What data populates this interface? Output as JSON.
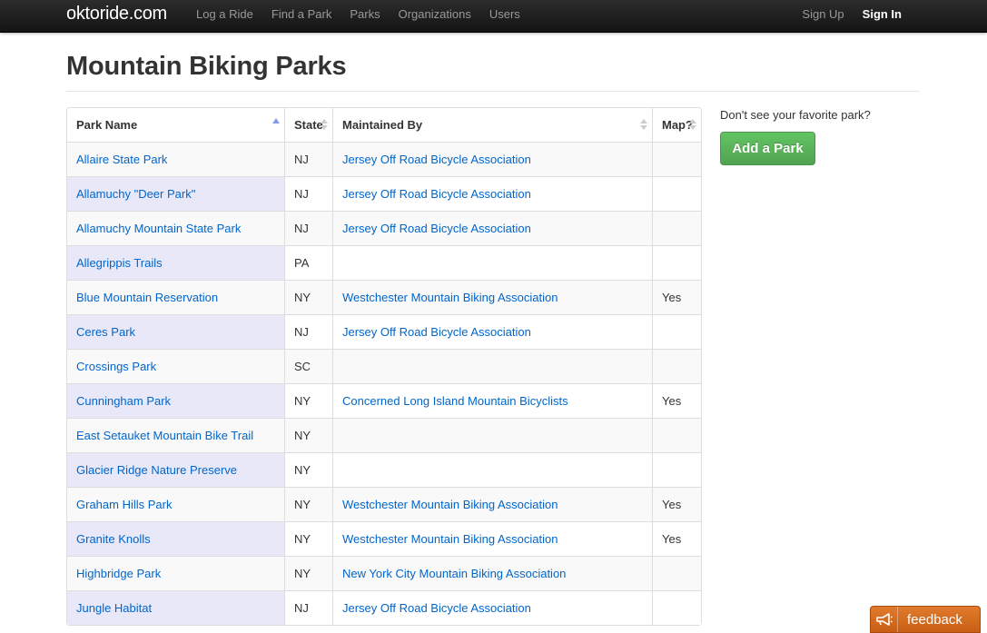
{
  "navbar": {
    "brand": "oktoride.com",
    "links": [
      "Log a Ride",
      "Find a Park",
      "Parks",
      "Organizations",
      "Users"
    ],
    "sign_up": "Sign Up",
    "sign_in": "Sign In"
  },
  "page": {
    "title": "Mountain Biking Parks"
  },
  "table": {
    "headers": {
      "park_name": "Park Name",
      "state": "State",
      "maintained_by": "Maintained By",
      "map": "Map?"
    },
    "rows": [
      {
        "name": "Allaire State Park",
        "state": "NJ",
        "org": "Jersey Off Road Bicycle Association",
        "map": ""
      },
      {
        "name": "Allamuchy \"Deer Park\"",
        "state": "NJ",
        "org": "Jersey Off Road Bicycle Association",
        "map": ""
      },
      {
        "name": "Allamuchy Mountain State Park",
        "state": "NJ",
        "org": "Jersey Off Road Bicycle Association",
        "map": ""
      },
      {
        "name": "Allegrippis Trails",
        "state": "PA",
        "org": "",
        "map": ""
      },
      {
        "name": "Blue Mountain Reservation",
        "state": "NY",
        "org": "Westchester Mountain Biking Association",
        "map": "Yes"
      },
      {
        "name": "Ceres Park",
        "state": "NJ",
        "org": "Jersey Off Road Bicycle Association",
        "map": ""
      },
      {
        "name": "Crossings Park",
        "state": "SC",
        "org": "",
        "map": ""
      },
      {
        "name": "Cunningham Park",
        "state": "NY",
        "org": "Concerned Long Island Mountain Bicyclists",
        "map": "Yes"
      },
      {
        "name": "East Setauket Mountain Bike Trail",
        "state": "NY",
        "org": "",
        "map": ""
      },
      {
        "name": "Glacier Ridge Nature Preserve",
        "state": "NY",
        "org": "",
        "map": ""
      },
      {
        "name": "Graham Hills Park",
        "state": "NY",
        "org": "Westchester Mountain Biking Association",
        "map": "Yes"
      },
      {
        "name": "Granite Knolls",
        "state": "NY",
        "org": "Westchester Mountain Biking Association",
        "map": "Yes"
      },
      {
        "name": "Highbridge Park",
        "state": "NY",
        "org": "New York City Mountain Biking Association",
        "map": ""
      },
      {
        "name": "Jungle Habitat",
        "state": "NJ",
        "org": "Jersey Off Road Bicycle Association",
        "map": ""
      }
    ]
  },
  "sidebar": {
    "prompt": "Don't see your favorite park?",
    "add_button": "Add a Park"
  },
  "feedback": {
    "label": "feedback",
    "icon": "megaphone-icon"
  },
  "colors": {
    "link": "#0066cc",
    "navbar": "#1b1b1b",
    "button_green": "#5bb75b",
    "feedback_orange": "#d96b1f",
    "name_col_highlight": "#e8e8f8"
  }
}
